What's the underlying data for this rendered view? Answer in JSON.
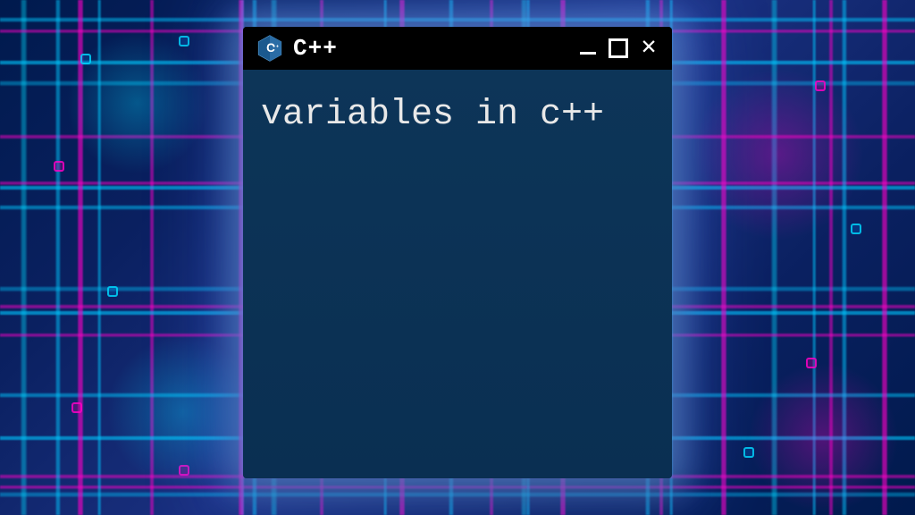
{
  "window": {
    "title": "C++",
    "app_icon": "cpp-logo-icon"
  },
  "controls": {
    "minimize": "–",
    "maximize": "□",
    "close": "✕"
  },
  "content": {
    "text": "variables in c++"
  }
}
